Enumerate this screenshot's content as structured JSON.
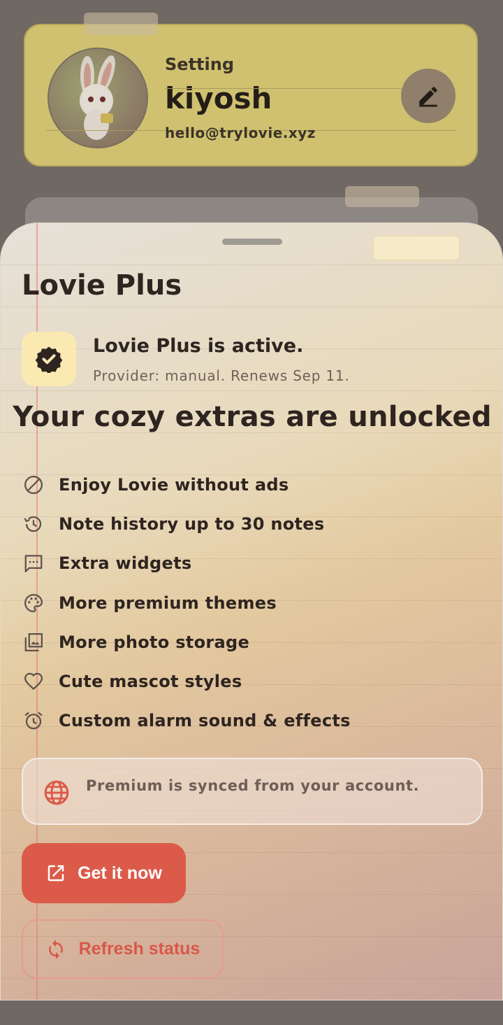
{
  "background": {
    "profile": {
      "kicker": "Setting",
      "name": "kiyosh",
      "email": "hello@trylovie.xyz"
    }
  },
  "sheet": {
    "title": "Lovie Plus",
    "status": {
      "title": "Lovie Plus is active.",
      "subtitle": "Provider: manual. Renews Sep 11."
    },
    "headline": "Your cozy extras are unlocked",
    "features": [
      {
        "icon": "block-icon",
        "label": "Enjoy Lovie without ads"
      },
      {
        "icon": "history-icon",
        "label": "Note history up to 30 notes"
      },
      {
        "icon": "chat-icon",
        "label": "Extra widgets"
      },
      {
        "icon": "palette-icon",
        "label": "More premium themes"
      },
      {
        "icon": "photo-library-icon",
        "label": "More photo storage"
      },
      {
        "icon": "heart-icon",
        "label": "Cute mascot styles"
      },
      {
        "icon": "alarm-icon",
        "label": "Custom alarm sound & effects"
      }
    ],
    "sync_note": "Premium is synced from your account.",
    "primary_button": "Get it now",
    "secondary_button": "Refresh status"
  },
  "colors": {
    "accent": "#dc5a49",
    "badge_bg": "#faeab2",
    "text_dark": "#2e2420"
  }
}
